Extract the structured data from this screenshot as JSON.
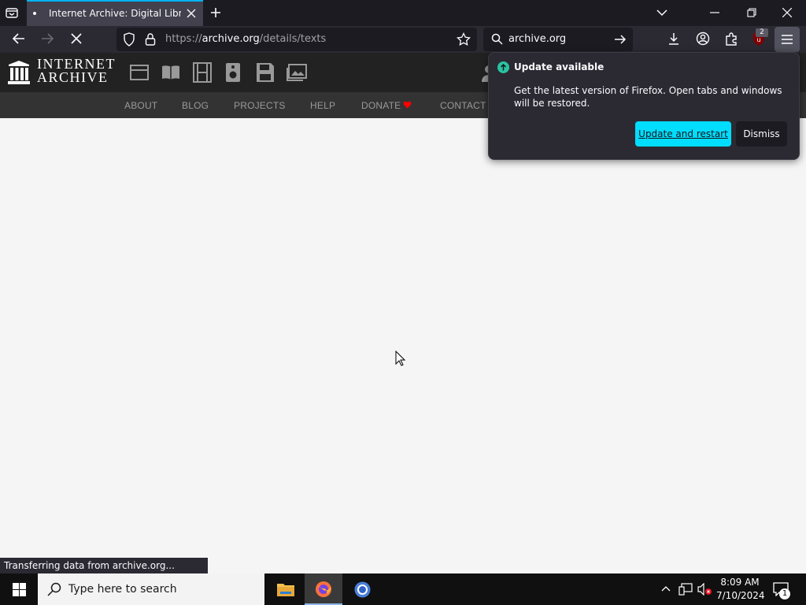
{
  "browser": {
    "tab": {
      "title": "Internet Archive: Digital Library of Free & Borrowable Books, Movies, Music & Wayback Machine"
    },
    "url": {
      "scheme": "https://",
      "host": "archive.org",
      "path": "/details/texts"
    },
    "search": {
      "value": "archive.org"
    },
    "extension_badge": "2",
    "status": "Transferring data from archive.org..."
  },
  "site": {
    "logo": {
      "line1": "INTERNET",
      "line2": "ARCHIVE"
    },
    "nav": [
      {
        "label": "ABOUT"
      },
      {
        "label": "BLOG"
      },
      {
        "label": "PROJECTS"
      },
      {
        "label": "HELP"
      },
      {
        "label": "DONATE"
      },
      {
        "label": "CONTACT"
      }
    ]
  },
  "update_panel": {
    "title": "Update available",
    "body": "Get the latest version of Firefox. Open tabs and windows will be restored.",
    "primary_label": "Update and restart",
    "secondary_label": "Dismiss"
  },
  "taskbar": {
    "search_placeholder": "Type here to search",
    "time": "8:09 AM",
    "date": "7/10/2024",
    "notification_count": "1"
  },
  "colors": {
    "accent": "#00ddff",
    "tab_highlight": "#00b3f4",
    "update_icon": "#2ac3a2",
    "donate_heart": "#ff0000"
  }
}
